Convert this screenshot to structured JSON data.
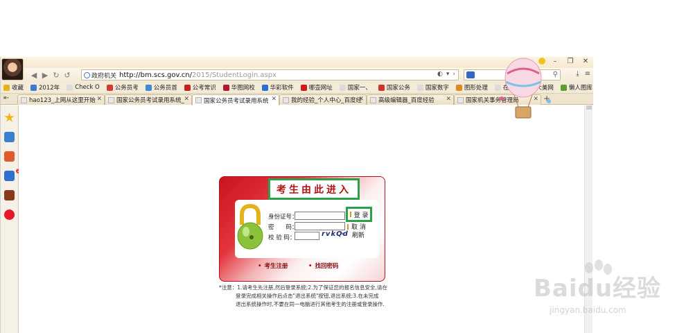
{
  "window": {
    "controls": [
      "–",
      "❐",
      "✕"
    ]
  },
  "address_bar": {
    "site_label": "政府机关",
    "url_main": "http://bm.scs.gov.cn/",
    "url_path": "2015/StudentLogin.aspx"
  },
  "bookmarks": {
    "items": [
      {
        "label": "收藏",
        "color": "#e8b21e"
      },
      {
        "label": "2012年",
        "color": "#3d7bd1"
      },
      {
        "label": "Check O",
        "color": "#dcdcdc"
      },
      {
        "label": "公务员考",
        "color": "#d13c2b"
      },
      {
        "label": "公务员首",
        "color": "#3d8bd1"
      },
      {
        "label": "公考常识",
        "color": "#c8201b"
      },
      {
        "label": "华图网校",
        "color": "#b5172b"
      },
      {
        "label": "华彩软件",
        "color": "#2b6fd1"
      },
      {
        "label": "哪壶网址",
        "color": "#d11b1b"
      },
      {
        "label": "国家一、",
        "color": "#dcdcdc"
      },
      {
        "label": "国家公务",
        "color": "#d1312b"
      },
      {
        "label": "国家数字",
        "color": "#dcdcdc"
      },
      {
        "label": "图形处理",
        "color": "#e08a1e"
      },
      {
        "label": "在数字",
        "color": "#dcdcdc"
      },
      {
        "label": "大美网",
        "color": "#dcdcdc"
      },
      {
        "label": "懒人图库",
        "color": "#5aa12b"
      }
    ],
    "more": "»"
  },
  "tabs": [
    {
      "label": "hao123_上网从这里开始",
      "close": "✕"
    },
    {
      "label": "国家公务员考试录用系统_",
      "close": "✕"
    },
    {
      "label": "国家公务员考试录用系统",
      "close": "✕"
    },
    {
      "label": "我的经验_个人中心_百度经",
      "close": "✕"
    },
    {
      "label": "高级编辑器_百度经验",
      "close": "✕"
    },
    {
      "label": "国家机关事务管理局",
      "close": "✕"
    }
  ],
  "new_tab": "+",
  "login": {
    "title": "考生由此进入",
    "id_label": "身份证号：",
    "pwd_label": "密　　码：",
    "captcha_label": "校 验 码：",
    "captcha_code": "rvkQd",
    "captcha_arrow": "▾",
    "login_button": "登 录",
    "cancel_button": "取 消",
    "refresh_link": "刷新",
    "register_link": "考生注册",
    "forgot_link": "找回密码"
  },
  "notice": {
    "lines": [
      "*注意：1.请考生先注册,然后登录系统;2.为了保证您的报名信息安全,请在",
      "登录完成相关操作后点击\"退出系统\"按钮,退出系统;3.在未完成",
      "退出系统操作时,不要在同一电脑进行其他考生的注册或登录操作."
    ]
  },
  "watermark": {
    "brand": "Baidu经验",
    "domain": "jingyan.baidu.com"
  },
  "colors": {
    "accent_red": "#b40f17",
    "highlight_green": "#2aa24a"
  }
}
